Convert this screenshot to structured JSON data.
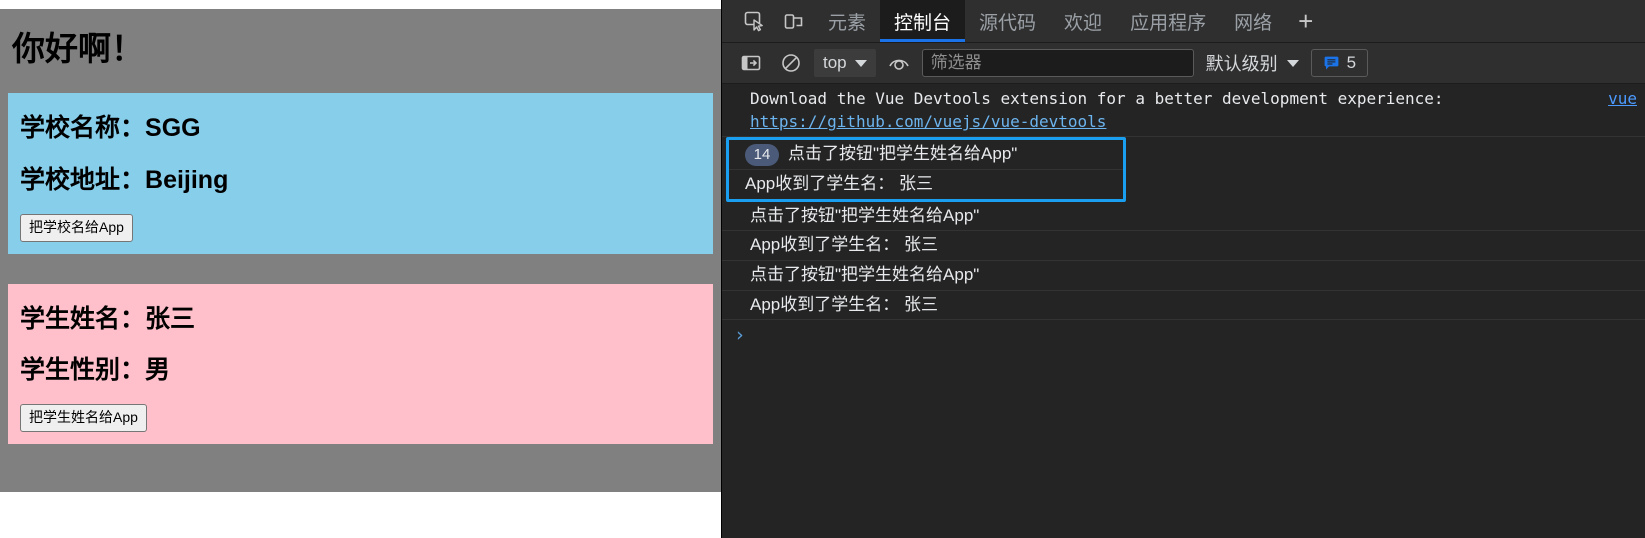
{
  "page": {
    "title": "你好啊！",
    "school_card": {
      "name_label": "学校名称：",
      "name_value": "SGG",
      "addr_label": "学校地址：",
      "addr_value": "Beijing",
      "button_label": "把学校名给App",
      "bg_color": "#87ceeb"
    },
    "student_card": {
      "name_label": "学生姓名：",
      "name_value": "张三",
      "gender_label": "学生性别：",
      "gender_value": "男",
      "button_label": "把学生姓名给App",
      "bg_color": "#ffc0cb"
    },
    "bg_color": "#808080"
  },
  "devtools": {
    "tabs": [
      {
        "label": "元素",
        "active": false
      },
      {
        "label": "控制台",
        "active": true
      },
      {
        "label": "源代码",
        "active": false
      },
      {
        "label": "欢迎",
        "active": false
      },
      {
        "label": "应用程序",
        "active": false
      },
      {
        "label": "网络",
        "active": false
      }
    ],
    "add_tab_label": "+",
    "icons": {
      "inspect": "inspect-element-icon",
      "device": "device-toolbar-icon",
      "sidebar": "console-sidebar-icon",
      "clear": "clear-console-icon",
      "eye": "live-expression-icon",
      "message": "message-count-icon"
    },
    "toolbar": {
      "context_value": "top",
      "filter_placeholder": "筛选器",
      "filter_value": "",
      "level_label": "默认级别",
      "message_count": "5"
    },
    "console": {
      "vue_notice_text": "Download the Vue Devtools extension for a better development experience:",
      "vue_notice_link": "https://github.com/vuejs/vue-devtools",
      "vue_source": "vue",
      "group": {
        "count": "14",
        "lines": [
          "点击了按钮\"把学生姓名给App\"",
          "App收到了学生名： 张三"
        ]
      },
      "messages": [
        "点击了按钮\"把学生姓名给App\"",
        "App收到了学生名： 张三",
        "点击了按钮\"把学生姓名给App\"",
        "App收到了学生名： 张三"
      ],
      "prompt_symbol": "›"
    }
  }
}
